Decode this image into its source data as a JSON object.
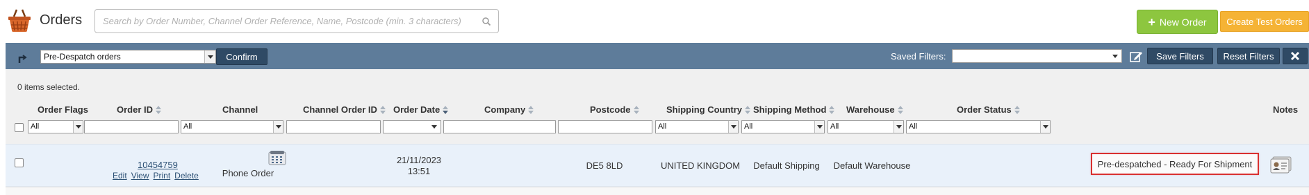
{
  "header": {
    "title": "Orders",
    "search_placeholder": "Search by Order Number, Channel Order Reference, Name, Postcode (min. 3 characters)",
    "new_order_label": "New Order",
    "create_test_orders_label": "Create Test Orders"
  },
  "filterbar": {
    "view_value": "Pre-Despatch orders",
    "confirm_label": "Confirm",
    "saved_filters_label": "Saved Filters:",
    "save_filters_label": "Save Filters",
    "reset_filters_label": "Reset Filters"
  },
  "grid": {
    "selected_count": "0 items selected.",
    "columns": {
      "order_flags": "Order Flags",
      "order_id": "Order ID",
      "channel": "Channel",
      "channel_order_id": "Channel Order ID",
      "order_date": "Order Date",
      "company": "Company",
      "postcode": "Postcode",
      "shipping_country": "Shipping Country",
      "shipping_method": "Shipping Method",
      "warehouse": "Warehouse",
      "order_status": "Order Status",
      "notes": "Notes"
    },
    "filters": {
      "order_flags": "All",
      "channel": "All",
      "shipping_country": "All",
      "shipping_method": "All",
      "warehouse": "All",
      "order_status": "All"
    },
    "rows": [
      {
        "order_id": "10454759",
        "actions": [
          "Edit",
          "View",
          "Print",
          "Delete"
        ],
        "channel": "Phone Order",
        "order_date": "21/11/2023",
        "order_time": "13:51",
        "postcode": "DE5 8LD",
        "shipping_country": "UNITED KINGDOM",
        "shipping_method": "Default Shipping",
        "warehouse": "Default Warehouse",
        "order_status": "Pre-despatched - Ready For Shipment"
      }
    ]
  },
  "colors": {
    "filterbar_bg": "#5e7c9a",
    "dark_button": "#2f4a65",
    "new_order_green": "#8dc63f",
    "test_orders_orange": "#f5b335",
    "status_highlight": "#d93030"
  }
}
